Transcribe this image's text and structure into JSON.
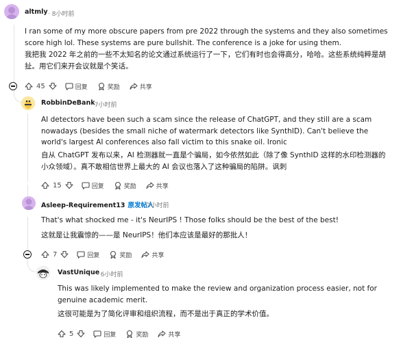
{
  "comments": [
    {
      "username": "altmly",
      "op_badge": "",
      "time": "8小时前",
      "text_en": "I ran some of my more obscure papers from pre 2022 through the systems and they also sometimes score high lol. These systems are pure bullshit. The conference is a joke for using them.",
      "text_zh": "我把我 2022 年之前的一些不太知名的论文通过系统运行了一下，它们有时也会得高分，哈哈。这些系统纯粹是胡扯。用它们来开会议就是个笑话。",
      "votes": "45",
      "reply": "回复",
      "award": "奖励",
      "share": "共享"
    },
    {
      "username": "RobbinDeBank",
      "op_badge": "",
      "time": "7小时前",
      "text_en": "AI detectors have been such a scam since the release of ChatGPT, and they still are a scam nowadays (besides the small niche of watermark detectors like SynthID). Can't believe the world's largest AI conferences also fall victim to this snake oil. Ironic",
      "text_zh": "自从 ChatGPT 发布以来，AI 检测器就一直是个骗局，如今依然如此（除了像 SynthID 这样的水印检测器的小众领域）。真不敢相信世界上最大的 AI 会议也落入了这种骗局的陷阱。讽刺",
      "votes": "15",
      "reply": "回复",
      "award": "奖励",
      "share": "共享"
    },
    {
      "username": "Asleep-Requirement13",
      "op_badge": "原发帖人",
      "time": "7小时前",
      "text_en": "That's what shocked me - it's NeurIPS ! Those folks should be the best of the best!",
      "text_zh": "这就是让我震惊的——是 NeurIPS！他们本应该是最好的那批人！",
      "votes": "7",
      "reply": "回复",
      "award": "奖励",
      "share": "共享"
    },
    {
      "username": "VastUnique",
      "op_badge": "",
      "time": "6小时前",
      "text_en": "This was likely implemented to make the review and organization process easier, not for genuine academic merit.",
      "text_zh": "这很可能是为了简化评审和组织流程，而不是出于真正的学术价值。",
      "votes": "5",
      "reply": "回复",
      "award": "奖励",
      "share": "共享"
    }
  ],
  "icons": {
    "upvote": "arrow-up-icon",
    "downvote": "arrow-down-icon",
    "reply": "speech-bubble-icon",
    "award": "award-icon",
    "share": "share-arrow-icon",
    "collapse": "collapse-minus-icon"
  },
  "colors": {
    "avatar_purple": "#d7b3ee",
    "avatar_yellow": "#f6c744",
    "op_badge": "#0079d3",
    "thread_line": "#dfe3e6",
    "meta_text": "#7c7c7c"
  }
}
